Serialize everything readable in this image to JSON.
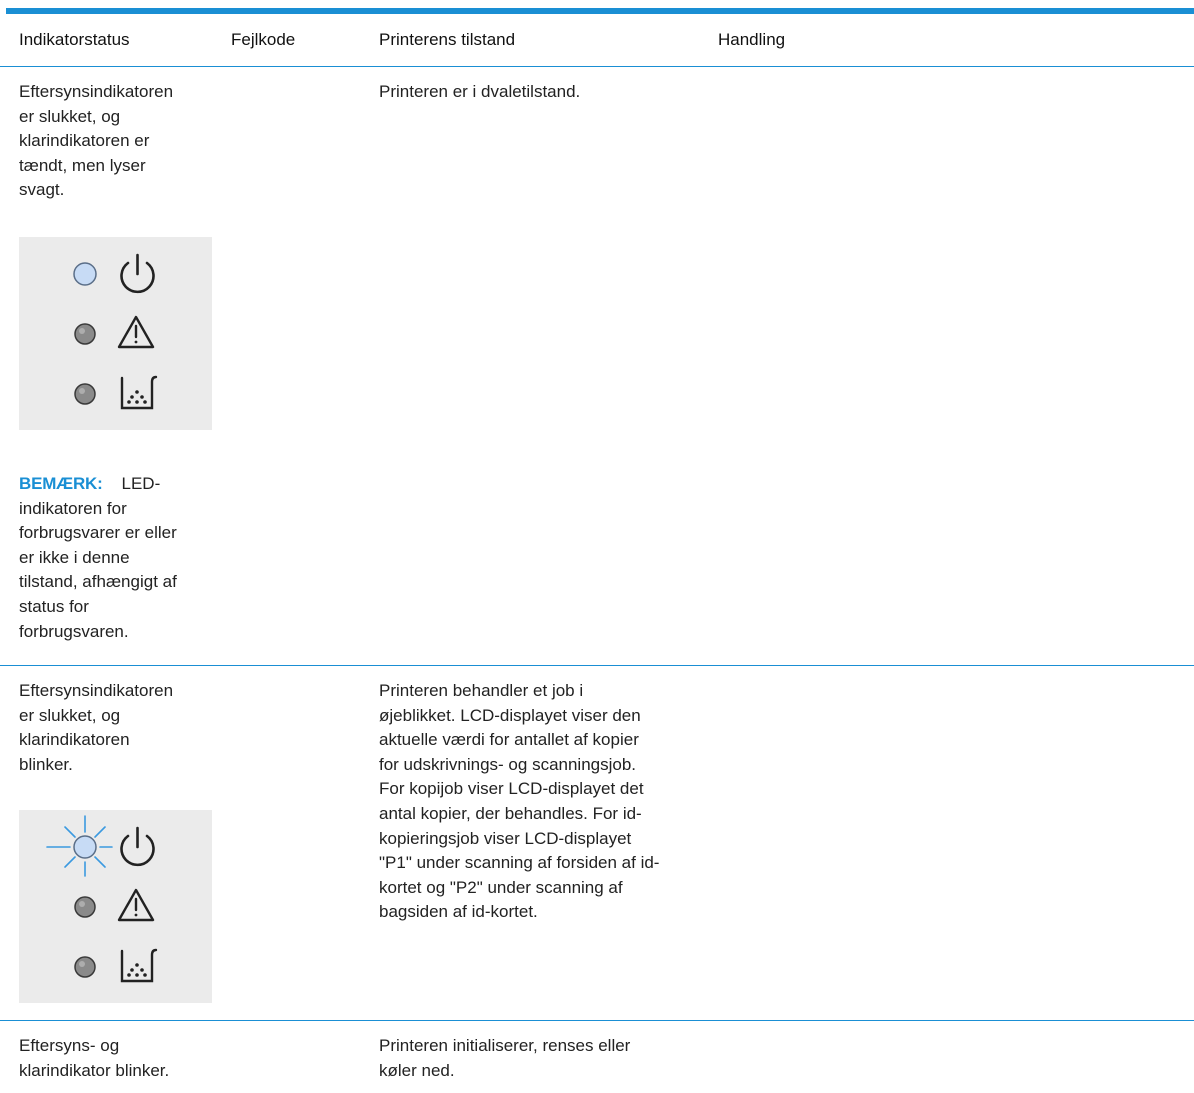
{
  "table": {
    "headers": {
      "indicator": "Indikatorstatus",
      "error_code": "Fejlkode",
      "printer_state": "Printerens tilstand",
      "action": "Handling"
    },
    "rows": [
      {
        "indicator": "Eftersynsindikatoren\ner slukket, og\nklarindikatoren er\ntændt, men lyser\nsvagt.",
        "printer_state": "Printeren er i dvaletilstand.",
        "note_label": "BEMÆRK:",
        "note_text": "LED-",
        "note_cont": "indikatoren for\nforbrugsvarer er eller\ner ikke i denne\ntilstand, afhængigt af\nstatus for\nforbrugsvaren.",
        "panel": {
          "ready_led": "on-dim",
          "attention_led": "off",
          "supplies_led": "off",
          "icons": [
            "power-icon",
            "warning-icon",
            "toner-icon"
          ]
        }
      },
      {
        "indicator": "Eftersynsindikatoren\ner slukket, og\nklarindikatoren\nblinker.",
        "printer_state": "Printeren behandler et job i\nøjeblikket. LCD-displayet viser den\naktuelle værdi for antallet af kopier\nfor udskrivnings- og scanningsjob.\nFor kopijob viser LCD-displayet det\nantal kopier, der behandles. For id-\nkopieringsjob viser LCD-displayet\n\"P1\" under scanning af forsiden af id-\nkortet og \"P2\" under scanning af\nbagsiden af id-kortet.",
        "panel": {
          "ready_led": "blinking",
          "attention_led": "off",
          "supplies_led": "off",
          "icons": [
            "power-icon",
            "warning-icon",
            "toner-icon"
          ]
        }
      },
      {
        "indicator": "Eftersyns- og\nklarindikator blinker.",
        "printer_state": "Printeren initialiserer, renses eller\nkøler ned."
      }
    ]
  },
  "colors": {
    "accent": "#1a8fd4",
    "led_on": "#c7dbf5",
    "led_off": "#8a8a8a",
    "panel_bg": "#ebebeb"
  }
}
